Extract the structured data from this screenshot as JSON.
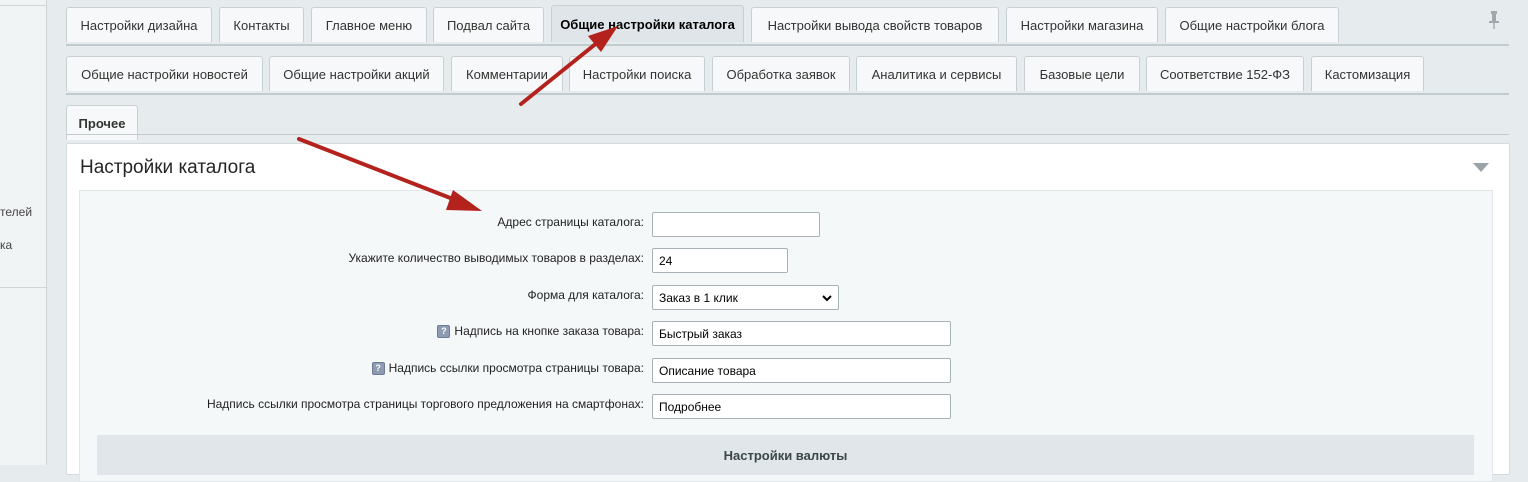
{
  "sidebar": {
    "item1": "телей",
    "item2": "ка"
  },
  "tabs": {
    "row1": [
      {
        "label": "Настройки дизайна"
      },
      {
        "label": "Контакты"
      },
      {
        "label": "Главное меню"
      },
      {
        "label": "Подвал сайта"
      },
      {
        "label": "Общие настройки каталога"
      },
      {
        "label": "Настройки вывода свойств товаров"
      },
      {
        "label": "Настройки магазина"
      },
      {
        "label": "Общие настройки блога"
      }
    ],
    "row2": [
      {
        "label": "Общие настройки новостей"
      },
      {
        "label": "Общие настройки акций"
      },
      {
        "label": "Комментарии"
      },
      {
        "label": "Настройки поиска"
      },
      {
        "label": "Обработка заявок"
      },
      {
        "label": "Аналитика и сервисы"
      },
      {
        "label": "Базовые цели"
      },
      {
        "label": "Соответствие 152-ФЗ"
      },
      {
        "label": "Кастомизация"
      }
    ],
    "row3": [
      {
        "label": "Прочее"
      }
    ],
    "active": "Общие настройки каталога"
  },
  "panel": {
    "title": "Настройки каталога",
    "fields": [
      {
        "label": "Адрес страницы каталога:",
        "value": "",
        "help": false
      },
      {
        "label": "Укажите количество выводимых товаров в разделах:",
        "value": "24",
        "help": false
      },
      {
        "label": "Форма для каталога:",
        "value": "Заказ в 1 клик",
        "help": false
      },
      {
        "label": "Надпись на кнопке заказа товара:",
        "value": "Быстрый заказ",
        "help": true
      },
      {
        "label": "Надпись ссылки просмотра страницы товара:",
        "value": "Описание товара",
        "help": true
      },
      {
        "label": "Надпись ссылки просмотра страницы торгового предложения на смартфонах:",
        "value": "Подробнее",
        "help": false
      }
    ],
    "section_header": "Настройки валюты"
  },
  "colors": {
    "arrow": "#b3221c",
    "active_tab": "#dfe5e8",
    "background": "#e6ebed"
  },
  "icons": {
    "pin": "pin-icon",
    "help": "help-icon",
    "collapse": "triangle-down-icon",
    "select_arrow": "chevron-down-icon"
  }
}
